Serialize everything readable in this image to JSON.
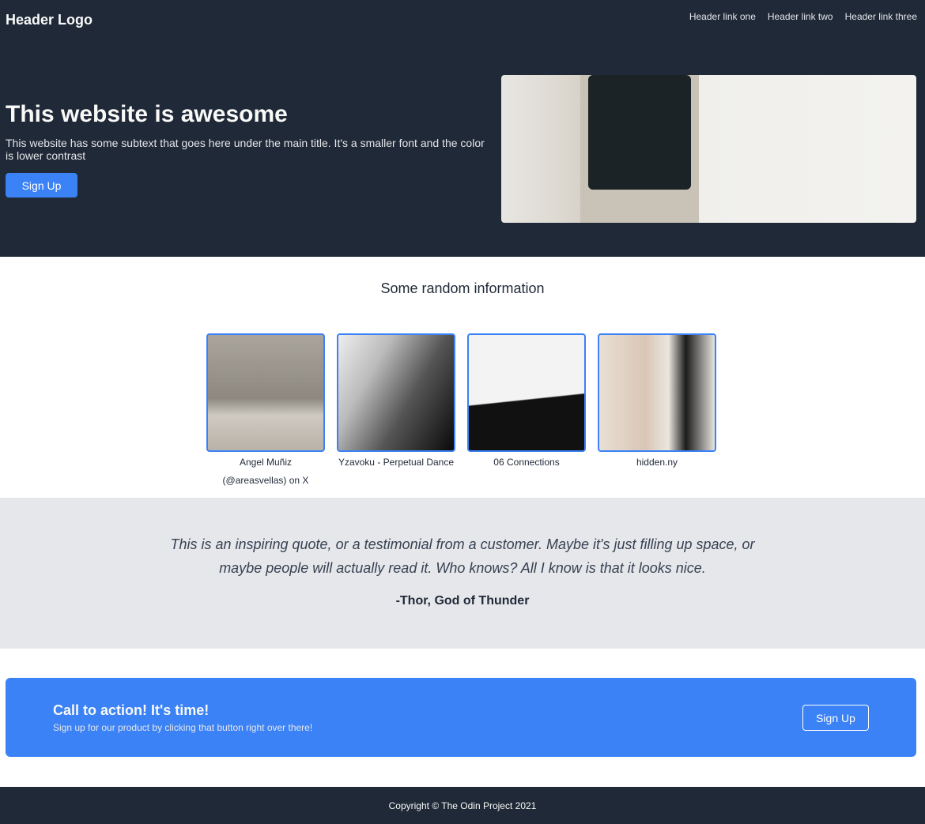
{
  "header": {
    "logo": "Header Logo",
    "links": [
      "Header link one",
      "Header link two",
      "Header link three"
    ]
  },
  "hero": {
    "title": "This website is awesome",
    "subtext": "This website has some subtext that goes here under the main title. It's a smaller font and the color is lower contrast",
    "button": "Sign Up"
  },
  "info": {
    "title": "Some random information",
    "cards": [
      {
        "caption": "Angel Muñiz (@areasvellas) on X"
      },
      {
        "caption": "Yzavoku - Perpetual Dance"
      },
      {
        "caption": "06 Connections"
      },
      {
        "caption": "hidden.ny"
      }
    ]
  },
  "quote": {
    "text": "This is an inspiring quote, or a testimonial from a customer. Maybe it's just filling up space, or maybe people will actually read it. Who knows? All I know is that it looks nice.",
    "author": "-Thor, God of Thunder"
  },
  "cta": {
    "title": "Call to action! It's time!",
    "subtext": "Sign up for our product by clicking that button right over there!",
    "button": "Sign Up"
  },
  "footer": {
    "text": "Copyright © The Odin Project 2021"
  },
  "colors": {
    "dark": "#1f2937",
    "accent": "#3b82f6",
    "light": "#e5e7eb"
  }
}
